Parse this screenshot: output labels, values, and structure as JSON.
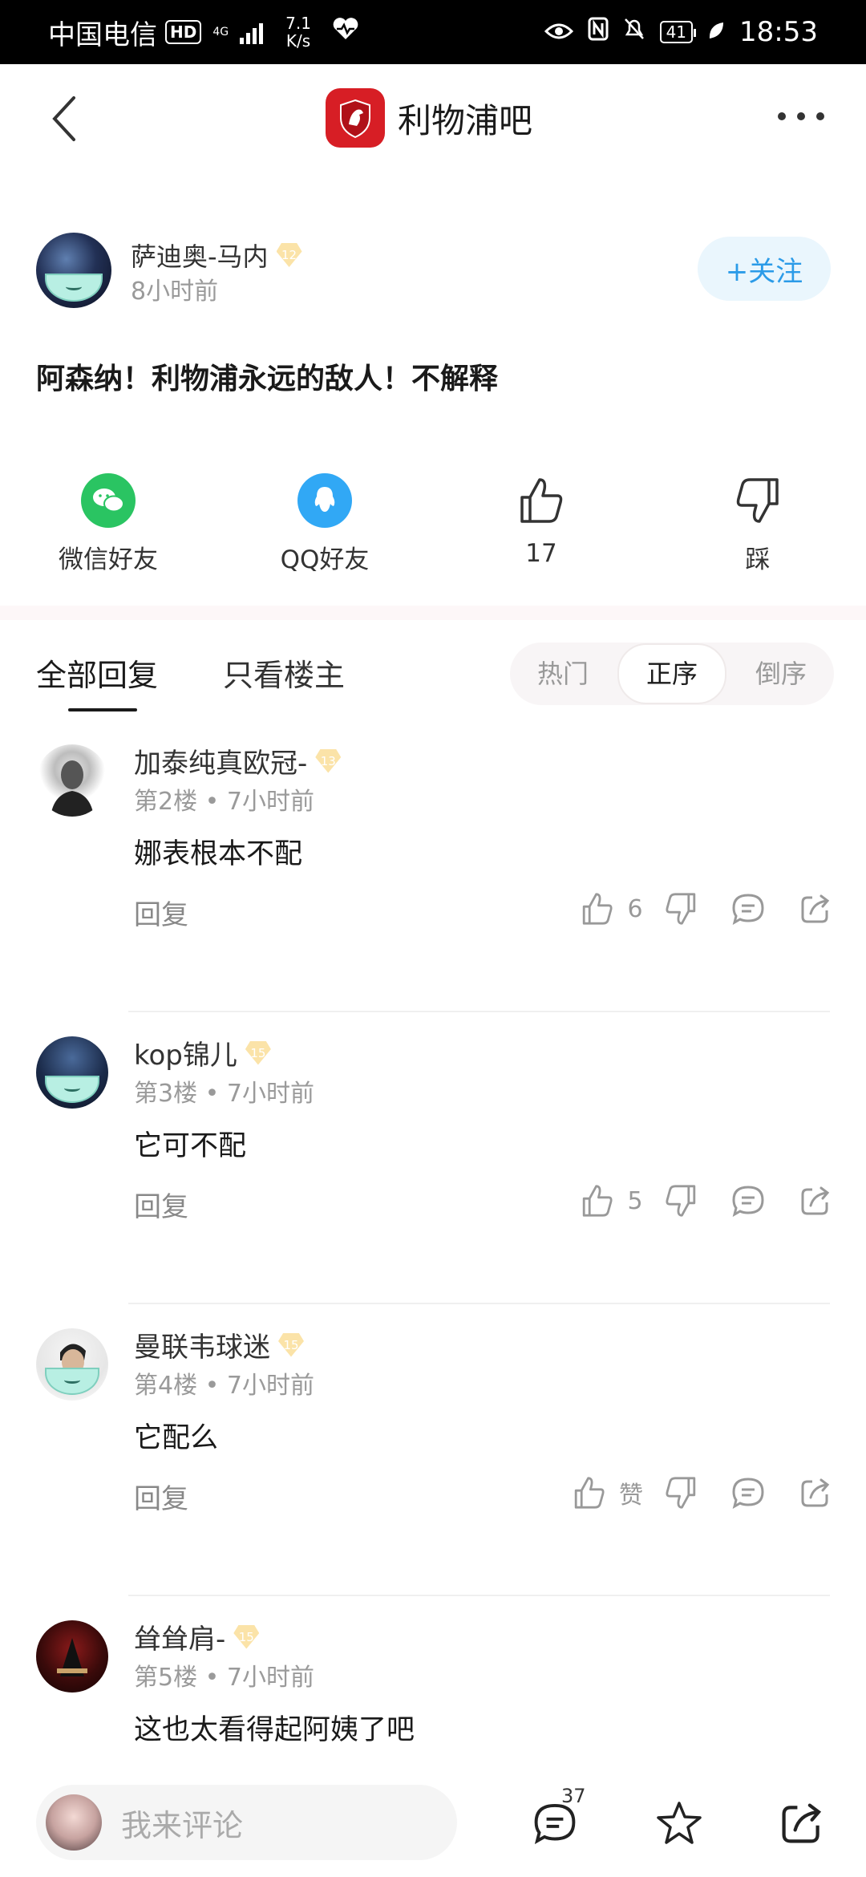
{
  "status_bar": {
    "carrier": "中国电信",
    "hd": "HD",
    "net_type": "4G",
    "speed_value": "7.1",
    "speed_unit": "K/s",
    "battery": "41",
    "time": "18:53"
  },
  "header": {
    "title": "利物浦吧"
  },
  "post": {
    "author": "萨迪奥-马内",
    "level": "12",
    "time": "8小时前",
    "follow_label": "+关注",
    "text": "阿森纳！利物浦永远的敌人！不解释"
  },
  "share": {
    "wechat_label": "微信好友",
    "qq_label": "QQ好友",
    "like_count": "17",
    "dislike_label": "踩"
  },
  "tabs": {
    "all_replies": "全部回复",
    "owner_only": "只看楼主"
  },
  "sort": {
    "hot": "热门",
    "asc": "正序",
    "desc": "倒序",
    "active": "正序"
  },
  "comments": [
    {
      "name": "加泰纯真欧冠-",
      "level": "13",
      "floor": "第2楼",
      "time": "7小时前",
      "text": "娜表根本不配",
      "reply_label": "回复",
      "likes": "6"
    },
    {
      "name": "kop锦儿",
      "level": "15",
      "floor": "第3楼",
      "time": "7小时前",
      "text": "它可不配",
      "reply_label": "回复",
      "likes": "5"
    },
    {
      "name": "曼联韦球迷",
      "level": "15",
      "floor": "第4楼",
      "time": "7小时前",
      "text": "它配么",
      "reply_label": "回复",
      "likes": "赞"
    },
    {
      "name": "耸耸肩-",
      "level": "15",
      "floor": "第5楼",
      "time": "7小时前",
      "text": "这也太看得起阿姨了吧",
      "reply_label": "",
      "likes": ""
    }
  ],
  "meta_separator": "•",
  "bottom_bar": {
    "input_placeholder": "我来评论",
    "comment_count": "37"
  },
  "colors": {
    "accent": "#2b9be8",
    "logo_red": "#d71e25",
    "wechat_green": "#2ac462",
    "qq_blue": "#31a8f5"
  }
}
